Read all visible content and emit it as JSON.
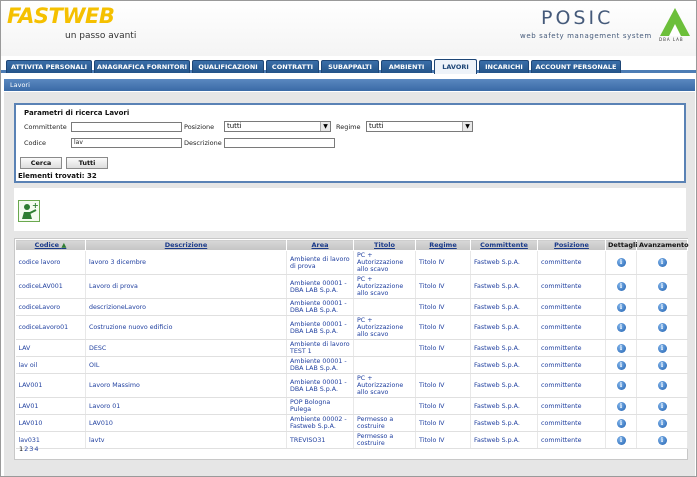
{
  "header": {
    "logo": "FASTWEB",
    "tagline": "un passo avanti",
    "product": "POSIC",
    "product_subtitle": "web safety management system",
    "vendor_logo": "DBA LAB"
  },
  "tabs": [
    {
      "label": "ATTIVITA PERSONALI"
    },
    {
      "label": "ANAGRAFICA FORNITORI"
    },
    {
      "label": "QUALIFICAZIONI"
    },
    {
      "label": "CONTRATTI"
    },
    {
      "label": "SUBAPPALTI"
    },
    {
      "label": "AMBIENTI"
    },
    {
      "label": "LAVORI",
      "active": true
    },
    {
      "label": "INCARICHI"
    },
    {
      "label": "ACCOUNT PERSONALE"
    }
  ],
  "section_title": "Lavori",
  "search": {
    "title": "Parametri di ricerca Lavori",
    "committente_label": "Committente",
    "committente_value": "",
    "posizione_label": "Posizione",
    "posizione_value": "tutti",
    "regime_label": "Regime",
    "regime_value": "tutti",
    "codice_label": "Codice",
    "codice_value": "lav",
    "descrizione_label": "Descrizione",
    "descrizione_value": "",
    "search_button": "Cerca",
    "all_button": "Tutti",
    "found_text": "Elementi trovati: 32"
  },
  "table": {
    "headers": [
      "Codice",
      "Descrizione",
      "Area",
      "Titolo",
      "Regime",
      "Committente",
      "Posizione",
      "Dettagli",
      "Avanzamento"
    ],
    "rows": [
      {
        "codice": "codice lavoro",
        "descrizione": "lavoro 3 dicembre",
        "area": "Ambiente di lavoro di prova",
        "titolo": "PC + Autorizzazione allo scavo",
        "regime": "Titolo IV",
        "committente": "Fastweb S.p.A.",
        "posizione": "committente"
      },
      {
        "codice": "codiceLAV001",
        "descrizione": "Lavoro di prova",
        "area": "Ambiente 00001 - DBA LAB S.p.A.",
        "titolo": "PC + Autorizzazione allo scavo",
        "regime": "Titolo IV",
        "committente": "Fastweb S.p.A.",
        "posizione": "committente"
      },
      {
        "codice": "codiceLavoro",
        "descrizione": "descrizioneLavoro",
        "area": "Ambiente 00001 - DBA LAB S.p.A.",
        "titolo": "",
        "regime": "Titolo IV",
        "committente": "Fastweb S.p.A.",
        "posizione": "committente"
      },
      {
        "codice": "codiceLavoro01",
        "descrizione": "Costruzione nuovo edificio",
        "area": "Ambiente 00001 - DBA LAB S.p.A.",
        "titolo": "PC + Autorizzazione allo scavo",
        "regime": "Titolo IV",
        "committente": "Fastweb S.p.A.",
        "posizione": "committente"
      },
      {
        "codice": "LAV",
        "descrizione": "DESC",
        "area": "Ambiente di lavoro TEST 1",
        "titolo": "",
        "regime": "Titolo IV",
        "committente": "Fastweb S.p.A.",
        "posizione": "committente"
      },
      {
        "codice": "lav oil",
        "descrizione": "OIL",
        "area": "Ambiente 00001 - DBA LAB S.p.A.",
        "titolo": "",
        "regime": "",
        "committente": "Fastweb S.p.A.",
        "posizione": "committente"
      },
      {
        "codice": "LAV001",
        "descrizione": "Lavoro Massimo",
        "area": "Ambiente 00001 - DBA LAB S.p.A.",
        "titolo": "PC + Autorizzazione allo scavo",
        "regime": "Titolo IV",
        "committente": "Fastweb S.p.A.",
        "posizione": "committente"
      },
      {
        "codice": "LAV01",
        "descrizione": "Lavoro 01",
        "area": "POP Bologna Pulega",
        "titolo": "",
        "regime": "Titolo IV",
        "committente": "Fastweb S.p.A.",
        "posizione": "committente"
      },
      {
        "codice": "LAV010",
        "descrizione": "LAV010",
        "area": "Ambiente 00002 - Fastweb S.p.A.",
        "titolo": "Permesso a costruire",
        "regime": "Titolo IV",
        "committente": "Fastweb S.p.A.",
        "posizione": "committente"
      },
      {
        "codice": "lav031",
        "descrizione": "lavtv",
        "area": "TREVISO31",
        "titolo": "Permesso a costruire",
        "regime": "Titolo IV",
        "committente": "Fastweb S.p.A.",
        "posizione": "committente"
      }
    ]
  },
  "pager": [
    "1",
    "2",
    "3",
    "4"
  ],
  "colors": {
    "tab_blue": "#245489",
    "accent_yellow": "#f5c000",
    "link_blue": "#1f3f9f"
  },
  "icons": {
    "add_work": "worker-add-icon",
    "info": "info-icon",
    "sort": "sort-arrow-icon"
  }
}
